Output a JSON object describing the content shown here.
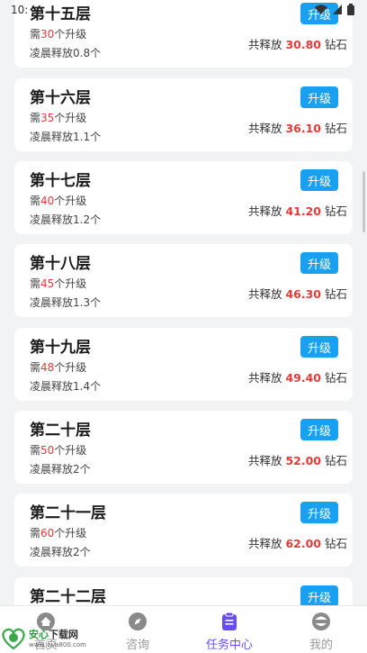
{
  "status": {
    "time": "10:"
  },
  "cards": [
    {
      "title": "第十五层",
      "need_prefix": "需",
      "need": "30",
      "need_suffix": "个升级",
      "daily": "凌晨释放0.8个",
      "release_prefix": "共释放",
      "release": "30.80",
      "release_suffix": "钻石",
      "button": "升级"
    },
    {
      "title": "第十六层",
      "need_prefix": "需",
      "need": "35",
      "need_suffix": "个升级",
      "daily": "凌晨释放1.1个",
      "release_prefix": "共释放",
      "release": "36.10",
      "release_suffix": "钻石",
      "button": "升级"
    },
    {
      "title": "第十七层",
      "need_prefix": "需",
      "need": "40",
      "need_suffix": "个升级",
      "daily": "凌晨释放1.2个",
      "release_prefix": "共释放",
      "release": "41.20",
      "release_suffix": "钻石",
      "button": "升级"
    },
    {
      "title": "第十八层",
      "need_prefix": "需",
      "need": "45",
      "need_suffix": "个升级",
      "daily": "凌晨释放1.3个",
      "release_prefix": "共释放",
      "release": "46.30",
      "release_suffix": "钻石",
      "button": "升级"
    },
    {
      "title": "第十九层",
      "need_prefix": "需",
      "need": "48",
      "need_suffix": "个升级",
      "daily": "凌晨释放1.4个",
      "release_prefix": "共释放",
      "release": "49.40",
      "release_suffix": "钻石",
      "button": "升级"
    },
    {
      "title": "第二十层",
      "need_prefix": "需",
      "need": "50",
      "need_suffix": "个升级",
      "daily": "凌晨释放2个",
      "release_prefix": "共释放",
      "release": "52.00",
      "release_suffix": "钻石",
      "button": "升级"
    },
    {
      "title": "第二十一层",
      "need_prefix": "需",
      "need": "60",
      "need_suffix": "个升级",
      "daily": "凌晨释放2个",
      "release_prefix": "共释放",
      "release": "62.00",
      "release_suffix": "钻石",
      "button": "升级"
    },
    {
      "title": "第二十二层",
      "button": "升级"
    }
  ],
  "tabs": [
    {
      "label": "首页",
      "icon": "home-icon"
    },
    {
      "label": "咨询",
      "icon": "compass-icon"
    },
    {
      "label": "任务中心",
      "icon": "clipboard-icon",
      "active": true
    },
    {
      "label": "我的",
      "icon": "profile-icon"
    }
  ],
  "watermark": {
    "main_a": "安心",
    "main_b": "下载网",
    "url": "www.java800.com"
  },
  "colors": {
    "accent": "#1aa0f0",
    "highlight": "#e63a3a",
    "tab_active": "#6a4cf5"
  }
}
